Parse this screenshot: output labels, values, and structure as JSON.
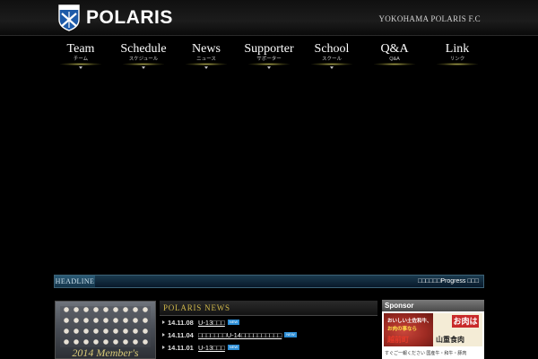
{
  "header": {
    "logo_text": "POLARIS",
    "logo_icon": "shield-icon",
    "club_name": "YOKOHAMA POLARIS F.C"
  },
  "nav": {
    "items": [
      {
        "label": "Team",
        "sub": "チーム"
      },
      {
        "label": "Schedule",
        "sub": "スケジュール"
      },
      {
        "label": "News",
        "sub": "ニュース"
      },
      {
        "label": "Supporter",
        "sub": "サポーター"
      },
      {
        "label": "School",
        "sub": "スクール"
      },
      {
        "label": "Q&A",
        "sub": "Q&A"
      },
      {
        "label": "Link",
        "sub": "リンク"
      }
    ]
  },
  "headline": {
    "tag": "HEADLINE",
    "text": "□□□□□□Progress □□□"
  },
  "members": {
    "caption": "2014 Member's"
  },
  "news": {
    "title": "POLARIS NEWS",
    "badge": "NEW",
    "items": [
      {
        "date": "14.11.08",
        "text": "U-13□□□"
      },
      {
        "date": "14.11.04",
        "text": "□□□□□□□U-14□□□□□□□□□□"
      },
      {
        "date": "14.11.01",
        "text": "U-13□□□"
      }
    ]
  },
  "sponsor": {
    "title": "Sponsor",
    "ad": {
      "copy1": "おいしい土佐和牛、",
      "copy2": "お肉の事なら",
      "area": "越前町",
      "brand": "お肉は",
      "shop": "山重食肉",
      "note": "すぐご一報ください 国産牛・和牛・豚肉"
    }
  },
  "colors": {
    "accent_gold": "#d0b84a",
    "headline_blue": "#1b3a4e",
    "new_badge": "#2d8ed6"
  }
}
